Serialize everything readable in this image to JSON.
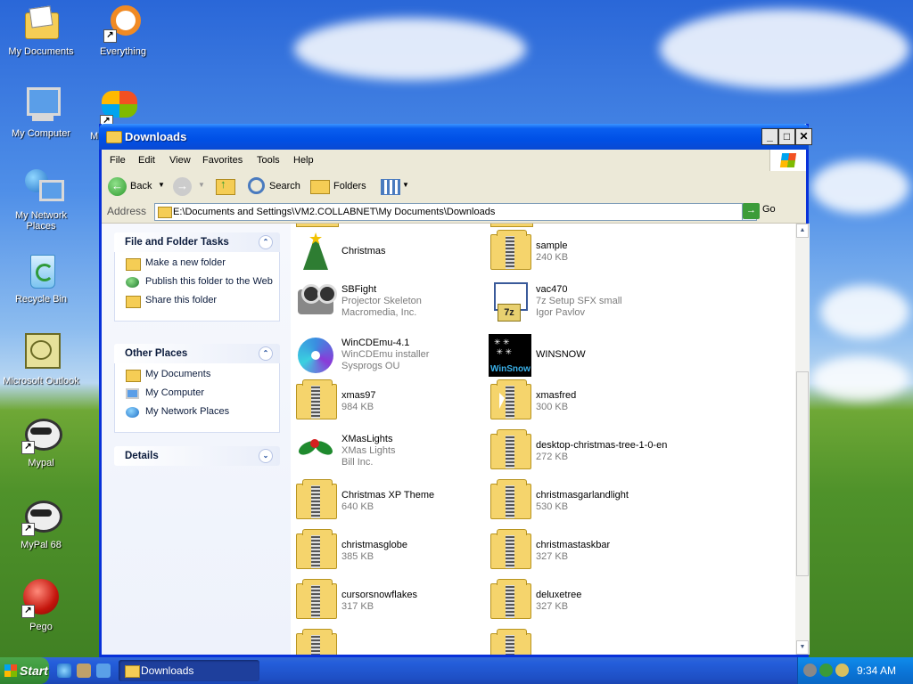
{
  "desktop": {
    "icons": [
      {
        "label": "My Documents"
      },
      {
        "label": "Everything"
      },
      {
        "label": "My Computer"
      },
      {
        "label": "M"
      },
      {
        "label": "My Network Places"
      },
      {
        "label": "Recycle Bin"
      },
      {
        "label": "Microsoft Outlook"
      },
      {
        "label": "Mypal"
      },
      {
        "label": "MyPal 68"
      },
      {
        "label": "Pego"
      }
    ]
  },
  "window": {
    "title": "Downloads",
    "menu": [
      "File",
      "Edit",
      "View",
      "Favorites",
      "Tools",
      "Help"
    ],
    "toolbar": {
      "back": "Back",
      "search": "Search",
      "folders": "Folders"
    },
    "address": {
      "label": "Address",
      "value": "E:\\Documents and Settings\\VM2.COLLABNET\\My Documents\\Downloads",
      "go": "Go"
    },
    "panels": {
      "tasks": {
        "title": "File and Folder Tasks",
        "items": [
          "Make a new folder",
          "Publish this folder to the Web",
          "Share this folder"
        ]
      },
      "places": {
        "title": "Other Places",
        "items": [
          "My Documents",
          "My Computer",
          "My Network Places"
        ]
      },
      "details": {
        "title": "Details"
      }
    },
    "files": [
      {
        "name": "Christmas",
        "l2": "",
        "l3": ""
      },
      {
        "name": "sample",
        "l2": "240 KB",
        "l3": ""
      },
      {
        "name": "SBFight",
        "l2": "Projector Skeleton",
        "l3": "Macromedia, Inc."
      },
      {
        "name": "vac470",
        "l2": "7z Setup SFX small",
        "l3": "Igor Pavlov"
      },
      {
        "name": "WinCDEmu-4.1",
        "l2": "WinCDEmu installer",
        "l3": "Sysprogs OU"
      },
      {
        "name": "WINSNOW",
        "l2": "",
        "l3": ""
      },
      {
        "name": "xmas97",
        "l2": "984 KB",
        "l3": ""
      },
      {
        "name": "xmasfred",
        "l2": "300 KB",
        "l3": ""
      },
      {
        "name": "XMasLights",
        "l2": "XMas Lights",
        "l3": "Bill Inc."
      },
      {
        "name": "desktop-christmas-tree-1-0-en",
        "l2": "272 KB",
        "l3": ""
      },
      {
        "name": "Christmas XP Theme",
        "l2": "640 KB",
        "l3": ""
      },
      {
        "name": "christmasgarlandlight",
        "l2": "530 KB",
        "l3": ""
      },
      {
        "name": "christmasglobe",
        "l2": "385 KB",
        "l3": ""
      },
      {
        "name": "christmastaskbar",
        "l2": "327 KB",
        "l3": ""
      },
      {
        "name": "cursorsnowflakes",
        "l2": "317 KB",
        "l3": ""
      },
      {
        "name": "deluxetree",
        "l2": "327 KB",
        "l3": ""
      }
    ]
  },
  "taskbar": {
    "start": "Start",
    "task": "Downloads",
    "clock": "9:34 AM"
  }
}
